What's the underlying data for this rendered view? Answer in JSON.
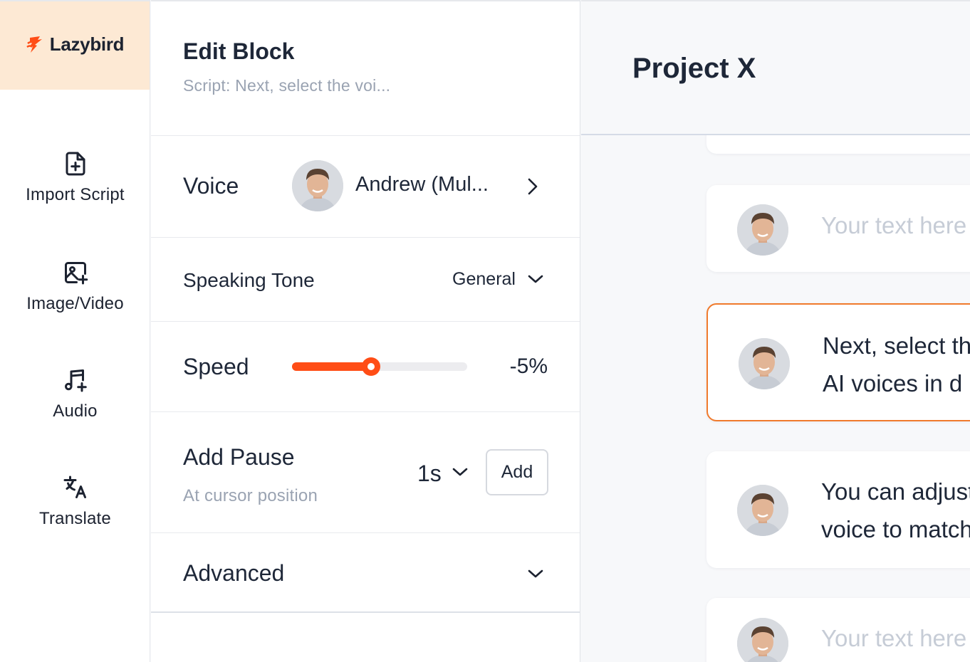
{
  "app": {
    "brand": "Lazybird",
    "accent": "#ff4d16",
    "logo_bg": "#fde9d4"
  },
  "nav": {
    "items": [
      {
        "label": "Import Script",
        "icon": "file-plus-icon"
      },
      {
        "label": "Image/Video",
        "icon": "image-plus-icon"
      },
      {
        "label": "Audio",
        "icon": "music-plus-icon"
      },
      {
        "label": "Translate",
        "icon": "translate-icon"
      }
    ]
  },
  "edit_panel": {
    "title": "Edit Block",
    "subtitle": "Script: Next, select the voi...",
    "voice": {
      "label": "Voice",
      "name": "Andrew (Mul..."
    },
    "tone": {
      "label": "Speaking Tone",
      "value": "General"
    },
    "speed": {
      "label": "Speed",
      "value": "-5%",
      "slider_fraction": 0.45
    },
    "pause": {
      "label": "Add Pause",
      "sub": "At cursor position",
      "duration": "1s",
      "add_label": "Add"
    },
    "advanced": {
      "label": "Advanced"
    }
  },
  "project": {
    "title": "Project X",
    "blocks": [
      {
        "lines": [
          "Your text here"
        ],
        "placeholder": true
      },
      {
        "lines": [
          "Next, select the",
          "AI voices in d"
        ],
        "active": true
      },
      {
        "lines": [
          "You can adjust",
          "voice to match"
        ]
      },
      {
        "lines": [
          "Your text here"
        ],
        "placeholder": true
      }
    ]
  }
}
